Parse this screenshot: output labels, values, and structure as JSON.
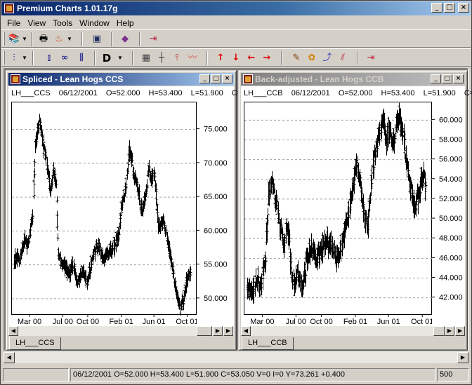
{
  "app": {
    "title": "Premium Charts 1.01.17g",
    "window_buttons": [
      "_",
      "□",
      "×"
    ]
  },
  "menu": [
    "File",
    "View",
    "Tools",
    "Window",
    "Help"
  ],
  "icons": {
    "toolbar1": [
      "books-icon",
      "print-preview-icon",
      "fire-icon",
      "computer-icon",
      "book-icon",
      "exit-door-icon"
    ],
    "toolbar2": [
      "bar-chart-style-icon",
      "bars-icon",
      "swap-icon",
      "bars-tall-icon",
      "grid-icon",
      "crosshair-icon",
      "marker-icon",
      "indicator-icon",
      "arrow-up-icon",
      "arrow-down-icon",
      "arrow-left-icon",
      "arrow-right-icon",
      "edit-icon",
      "palette-icon",
      "line-study-icon",
      "chart-study-icon",
      "exit-door-icon"
    ]
  },
  "toolbar2": {
    "period_label": "D"
  },
  "windows": [
    {
      "title": "Spliced  -  Lean Hogs CCS",
      "symbol": "LH___CCS",
      "date": "06/12/2001",
      "open": "O=52.000",
      "high": "H=53.400",
      "low": "L=51.900",
      "close": "C=5",
      "tab": "LH___CCS",
      "active": true
    },
    {
      "title": "Back-adjusted  -  Lean Hogs CCB",
      "symbol": "LH___CCB",
      "date": "06/12/2001",
      "open": "O=52.000",
      "high": "H=53.400",
      "low": "L=51.900",
      "close": "C=5",
      "tab": "LH___CCB",
      "active": false
    }
  ],
  "chart_data": [
    {
      "type": "bar",
      "title": "",
      "x_ticks": [
        "Mar 00",
        "Jul 00",
        "Oct 00",
        "Feb 01",
        "Jun 01",
        "Oct 01"
      ],
      "y_ticks": [
        50,
        55,
        60,
        65,
        70,
        75
      ],
      "y_tick_labels": [
        "50.000",
        "55.000",
        "60.000",
        "65.000",
        "70.000",
        "75.000"
      ],
      "ylim": [
        47.5,
        79
      ],
      "grid": "horizontal-dashed",
      "anchor_points": [
        [
          "2000-01-03",
          56.0
        ],
        [
          "2000-01-20",
          55.5
        ],
        [
          "2000-02-08",
          59.0
        ],
        [
          "2000-02-20",
          57.5
        ],
        [
          "2000-03-10",
          62.0
        ],
        [
          "2000-03-20",
          73.0
        ],
        [
          "2000-04-03",
          76.5
        ],
        [
          "2000-04-15",
          73.5
        ],
        [
          "2000-05-01",
          69.5
        ],
        [
          "2000-05-15",
          66.0
        ],
        [
          "2000-05-25",
          69.0
        ],
        [
          "2000-06-05",
          66.5
        ],
        [
          "2000-06-10",
          57.5
        ],
        [
          "2000-06-20",
          55.5
        ],
        [
          "2000-07-05",
          55.0
        ],
        [
          "2000-07-20",
          53.5
        ],
        [
          "2000-08-05",
          55.0
        ],
        [
          "2000-08-20",
          52.5
        ],
        [
          "2000-09-10",
          54.0
        ],
        [
          "2000-09-25",
          52.0
        ],
        [
          "2000-10-15",
          56.0
        ],
        [
          "2000-11-05",
          58.0
        ],
        [
          "2000-11-25",
          56.0
        ],
        [
          "2000-12-20",
          57.0
        ],
        [
          "2001-01-15",
          58.5
        ],
        [
          "2001-02-01",
          64.0
        ],
        [
          "2001-02-15",
          66.5
        ],
        [
          "2001-03-01",
          72.0
        ],
        [
          "2001-03-15",
          68.5
        ],
        [
          "2001-04-01",
          66.0
        ],
        [
          "2001-04-15",
          63.0
        ],
        [
          "2001-05-01",
          66.0
        ],
        [
          "2001-05-10",
          69.0
        ],
        [
          "2001-05-20",
          68.0
        ],
        [
          "2001-06-01",
          68.5
        ],
        [
          "2001-06-15",
          60.5
        ],
        [
          "2001-07-05",
          61.0
        ],
        [
          "2001-07-20",
          58.0
        ],
        [
          "2001-08-05",
          55.0
        ],
        [
          "2001-08-20",
          50.5
        ],
        [
          "2001-09-01",
          48.5
        ],
        [
          "2001-09-15",
          50.0
        ],
        [
          "2001-10-01",
          53.5
        ],
        [
          "2001-10-10",
          54.0
        ]
      ]
    },
    {
      "type": "bar",
      "title": "",
      "x_ticks": [
        "Mar 00",
        "Jul 00",
        "Oct 00",
        "Feb 01",
        "Jun 01",
        "Oct 01"
      ],
      "y_ticks": [
        42,
        44,
        46,
        48,
        50,
        52,
        54,
        56,
        58,
        60
      ],
      "y_tick_labels": [
        "42.000",
        "44.000",
        "46.000",
        "48.000",
        "50.000",
        "52.000",
        "54.000",
        "56.000",
        "58.000",
        "60.000"
      ],
      "ylim": [
        40.2,
        61.8
      ],
      "grid": "horizontal-dashed",
      "anchor_points": [
        [
          "2000-01-03",
          43.5
        ],
        [
          "2000-01-20",
          42.5
        ],
        [
          "2000-02-08",
          44.0
        ],
        [
          "2000-02-20",
          43.0
        ],
        [
          "2000-03-10",
          46.0
        ],
        [
          "2000-03-20",
          52.0
        ],
        [
          "2000-04-03",
          54.0
        ],
        [
          "2000-04-15",
          52.0
        ],
        [
          "2000-05-01",
          49.5
        ],
        [
          "2000-05-15",
          47.0
        ],
        [
          "2000-05-25",
          49.5
        ],
        [
          "2000-06-05",
          47.5
        ],
        [
          "2000-06-10",
          44.5
        ],
        [
          "2000-06-20",
          43.5
        ],
        [
          "2000-07-05",
          44.5
        ],
        [
          "2000-07-20",
          43.0
        ],
        [
          "2000-08-05",
          45.5
        ],
        [
          "2000-08-20",
          47.0
        ],
        [
          "2000-09-10",
          46.0
        ],
        [
          "2000-09-25",
          46.5
        ],
        [
          "2000-10-15",
          48.0
        ],
        [
          "2000-11-05",
          47.0
        ],
        [
          "2000-11-25",
          46.0
        ],
        [
          "2000-12-20",
          48.5
        ],
        [
          "2001-01-15",
          52.0
        ],
        [
          "2001-02-01",
          55.5
        ],
        [
          "2001-02-15",
          54.0
        ],
        [
          "2001-03-01",
          50.5
        ],
        [
          "2001-03-15",
          49.5
        ],
        [
          "2001-04-01",
          55.0
        ],
        [
          "2001-04-15",
          57.5
        ],
        [
          "2001-05-01",
          59.0
        ],
        [
          "2001-05-10",
          60.5
        ],
        [
          "2001-05-20",
          58.0
        ],
        [
          "2001-06-01",
          59.0
        ],
        [
          "2001-06-15",
          57.5
        ],
        [
          "2001-07-05",
          60.5
        ],
        [
          "2001-07-20",
          59.0
        ],
        [
          "2001-08-05",
          55.0
        ],
        [
          "2001-08-20",
          52.5
        ],
        [
          "2001-09-01",
          51.0
        ],
        [
          "2001-09-15",
          52.5
        ],
        [
          "2001-10-01",
          54.5
        ],
        [
          "2001-10-10",
          53.0
        ]
      ]
    }
  ],
  "status": {
    "quote": "06/12/2001  O=52.000  H=53.400  L=51.900  C=53.050  V=0  I=0  Y=73.261  +0.400",
    "count": "500"
  }
}
